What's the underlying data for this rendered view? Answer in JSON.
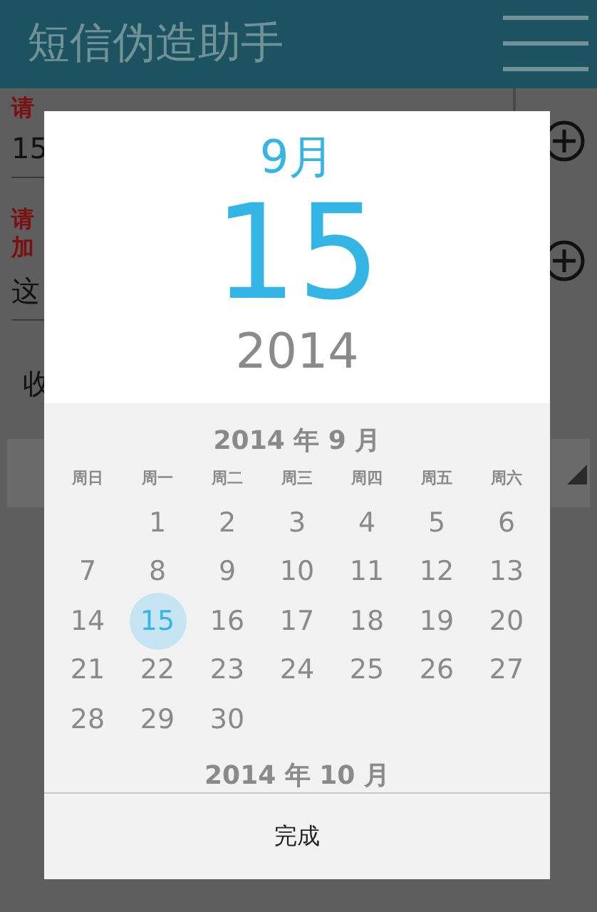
{
  "app_bar": {
    "title": "短信伪造助手"
  },
  "form": {
    "fields": [
      {
        "labels": [
          "请"
        ],
        "value": "15"
      },
      {
        "labels": [
          "请",
          "加"
        ],
        "value": "这"
      }
    ],
    "spinner": {
      "value": "收"
    }
  },
  "dialog": {
    "month": "9月",
    "day": "15",
    "year": "2014",
    "calendar": {
      "month_title": "2014 年 9 月",
      "weekdays": [
        "周日",
        "周一",
        "周二",
        "周三",
        "周四",
        "周五",
        "周六"
      ],
      "weeks": [
        [
          {
            "day": "1",
            "selected": false
          },
          {
            "day": "2",
            "selected": false
          },
          {
            "day": "3",
            "selected": false
          },
          {
            "day": "4",
            "selected": false
          },
          {
            "day": "5",
            "selected": false
          },
          {
            "day": "6",
            "selected": false
          }
        ],
        [
          {
            "day": "7",
            "selected": false
          },
          {
            "day": "8",
            "selected": false
          },
          {
            "day": "9",
            "selected": false
          },
          {
            "day": "10",
            "selected": false
          },
          {
            "day": "11",
            "selected": false
          },
          {
            "day": "12",
            "selected": false
          },
          {
            "day": "13",
            "selected": false
          }
        ],
        [
          {
            "day": "14",
            "selected": false
          },
          {
            "day": "15",
            "selected": true
          },
          {
            "day": "16",
            "selected": false
          },
          {
            "day": "17",
            "selected": false
          },
          {
            "day": "18",
            "selected": false
          },
          {
            "day": "19",
            "selected": false
          },
          {
            "day": "20",
            "selected": false
          }
        ],
        [
          {
            "day": "21",
            "selected": false
          },
          {
            "day": "22",
            "selected": false
          },
          {
            "day": "23",
            "selected": false
          },
          {
            "day": "24",
            "selected": false
          },
          {
            "day": "25",
            "selected": false
          },
          {
            "day": "26",
            "selected": false
          },
          {
            "day": "27",
            "selected": false
          }
        ],
        [
          {
            "day": "28",
            "selected": false
          },
          {
            "day": "29",
            "selected": false
          },
          {
            "day": "30",
            "selected": false
          }
        ]
      ],
      "next_month_title": "2014 年 10 月"
    },
    "done_button": "完成"
  }
}
